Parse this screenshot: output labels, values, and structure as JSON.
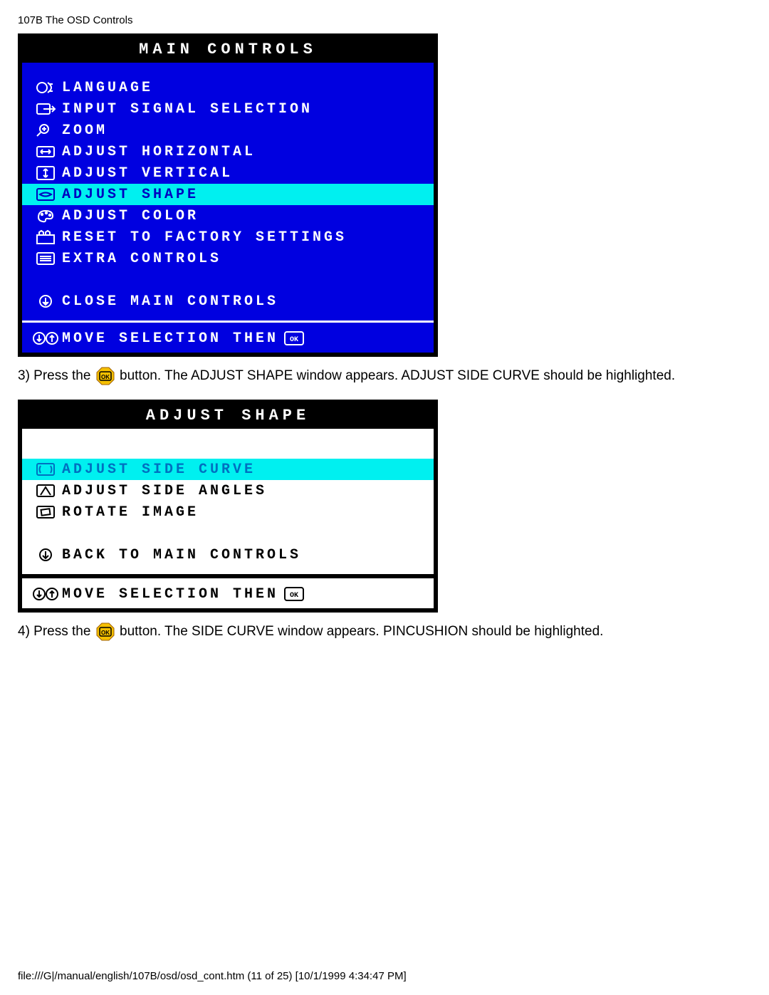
{
  "header": "107B The OSD Controls",
  "panel1": {
    "title": "MAIN CONTROLS",
    "items": [
      {
        "label": "LANGUAGE",
        "hl": false
      },
      {
        "label": "INPUT SIGNAL SELECTION",
        "hl": false
      },
      {
        "label": "ZOOM",
        "hl": false
      },
      {
        "label": "ADJUST HORIZONTAL",
        "hl": false
      },
      {
        "label": "ADJUST VERTICAL",
        "hl": false
      },
      {
        "label": "ADJUST SHAPE",
        "hl": true
      },
      {
        "label": "ADJUST COLOR",
        "hl": false
      },
      {
        "label": "RESET TO FACTORY SETTINGS",
        "hl": false
      },
      {
        "label": "EXTRA CONTROLS",
        "hl": false
      }
    ],
    "close": "CLOSE MAIN CONTROLS",
    "hint": "MOVE SELECTION THEN"
  },
  "instr3a": "3) Press the ",
  "instr3b": " button. The ADJUST SHAPE window appears. ADJUST SIDE CURVE should be highlighted.",
  "panel2": {
    "title": "ADJUST SHAPE",
    "items": [
      {
        "label": "ADJUST SIDE CURVE",
        "hl": true
      },
      {
        "label": "ADJUST SIDE ANGLES",
        "hl": false
      },
      {
        "label": "ROTATE IMAGE",
        "hl": false
      }
    ],
    "back": "BACK TO MAIN CONTROLS",
    "hint": "MOVE SELECTION THEN"
  },
  "instr4a": "4) Press the ",
  "instr4b": " button. The SIDE CURVE window appears. PINCUSHION should be highlighted.",
  "footer": "file:///G|/manual/english/107B/osd/osd_cont.htm (11 of 25) [10/1/1999 4:34:47 PM]"
}
